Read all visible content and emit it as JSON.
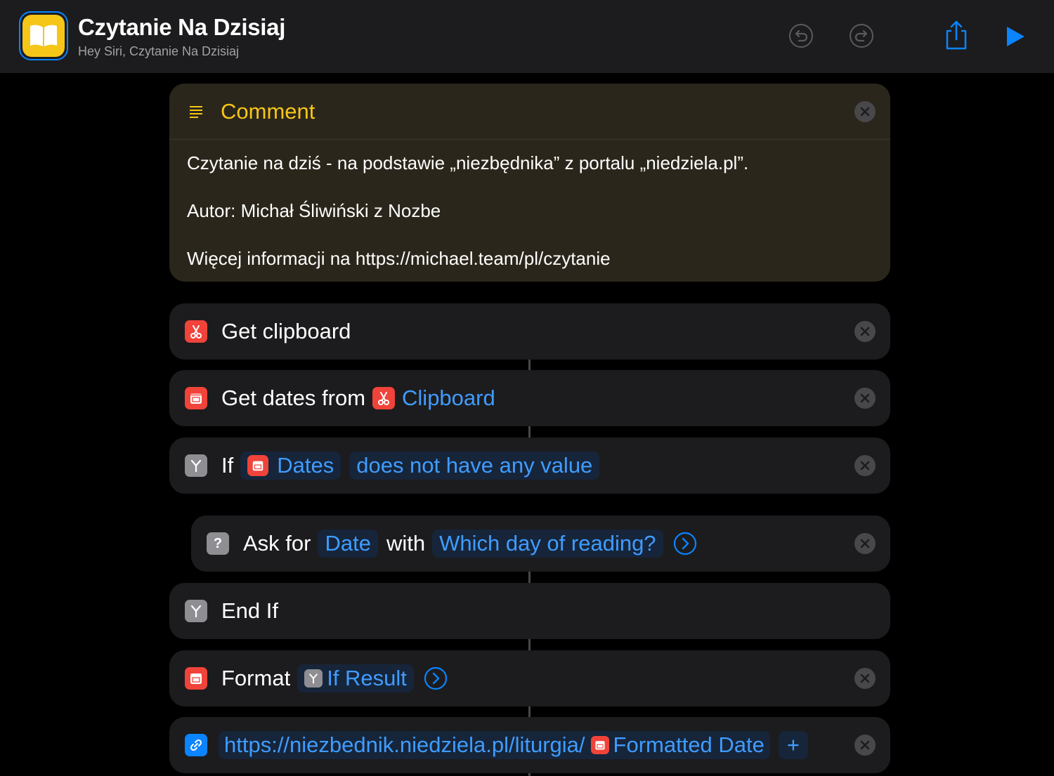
{
  "header": {
    "title": "Czytanie Na Dzisiaj",
    "subtitle": "Hey Siri, Czytanie Na Dzisiaj",
    "app_icon": "book-icon",
    "buttons": [
      "undo-icon",
      "redo-icon",
      "share-icon",
      "play-icon"
    ]
  },
  "comment": {
    "title": "Comment",
    "lines": [
      "Czytanie na dziś - na podstawie „niezbędnika” z portalu „niedziela.pl”.",
      "Autor: Michał Śliwiński z Nozbe",
      "Więcej informacji na https://michael.team/pl/czytanie"
    ]
  },
  "actions": {
    "get_clipboard": {
      "label": "Get clipboard"
    },
    "get_dates": {
      "label": "Get dates from",
      "variable": "Clipboard"
    },
    "if": {
      "label": "If",
      "variable": "Dates",
      "condition": "does not have any value"
    },
    "ask": {
      "label": "Ask for",
      "type": "Date",
      "with": "with",
      "prompt": "Which day of reading?"
    },
    "end_if": {
      "label": "End If"
    },
    "format": {
      "label": "Format",
      "variable": "If Result"
    },
    "url": {
      "text": "https://niezbednik.niedziela.pl/liturgia/",
      "variable": "Formatted Date",
      "add": "+"
    }
  },
  "colors": {
    "accent": "#409cff",
    "comment_title": "#f5c518",
    "card_bg": "#1c1c1e",
    "comment_bg": "#2b261b",
    "red_icon": "#f0433a",
    "gray_icon": "#8e8e93",
    "blue_icon": "#0a84ff"
  }
}
